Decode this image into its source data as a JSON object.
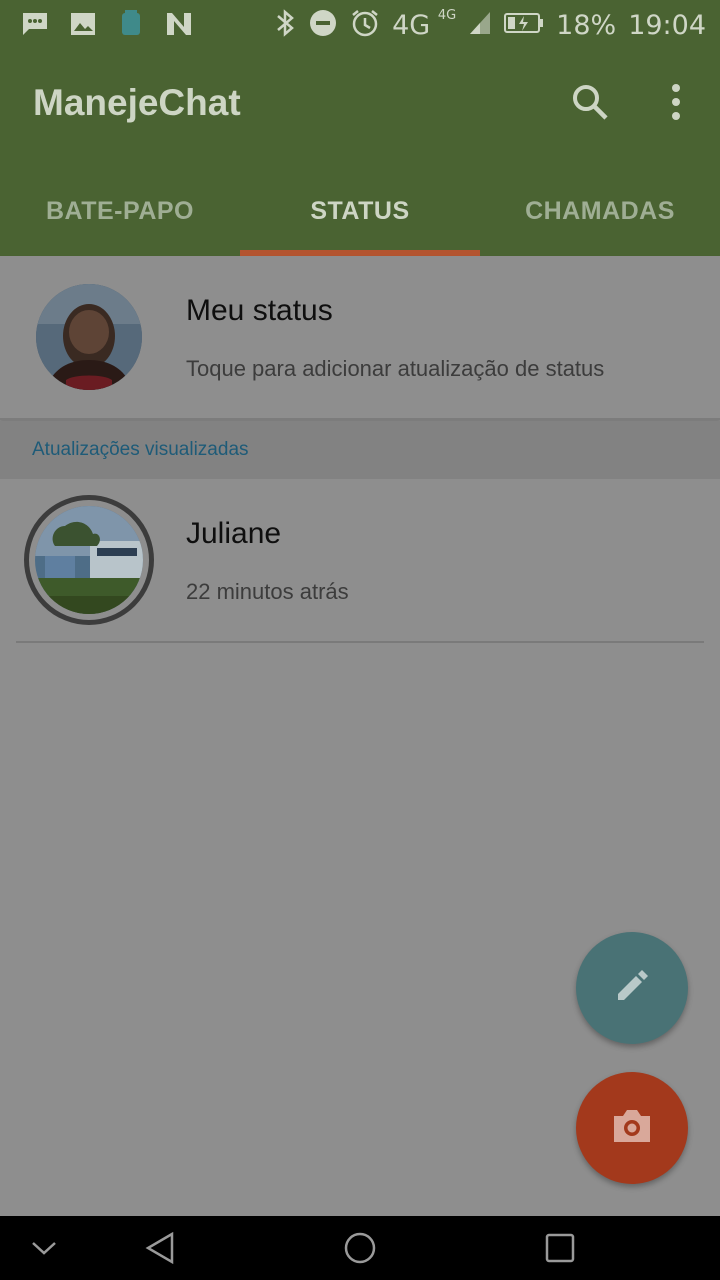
{
  "status_bar": {
    "left_icons": [
      "message-icon",
      "image-icon",
      "android-icon",
      "n-logo-icon"
    ],
    "network": "4G",
    "network_super": "4G",
    "battery_percent": "18%",
    "time": "19:04"
  },
  "app_bar": {
    "title": "ManejeChat",
    "search_icon": "search-icon",
    "menu_icon": "more-vert-icon"
  },
  "tabs": [
    {
      "label": "BATE-PAPO",
      "active": false
    },
    {
      "label": "STATUS",
      "active": true
    },
    {
      "label": "CHAMADAS",
      "active": false
    }
  ],
  "my_status": {
    "name": "Meu status",
    "subtitle": "Toque para adicionar atualização de status"
  },
  "section": {
    "label": "Atualizações visualizadas"
  },
  "status_items": [
    {
      "name": "Juliane",
      "time": "22 minutos atrás"
    }
  ],
  "fabs": {
    "edit_icon": "pencil-icon",
    "camera_icon": "camera-icon"
  },
  "nav_bar": {
    "buttons": [
      "chevron-down-icon",
      "back-icon",
      "home-icon",
      "recents-icon"
    ]
  },
  "colors": {
    "primary": "#4a6332",
    "accent_indicator": "#b3542f",
    "fab_edit": "#497275",
    "fab_camera": "#a3391c"
  }
}
